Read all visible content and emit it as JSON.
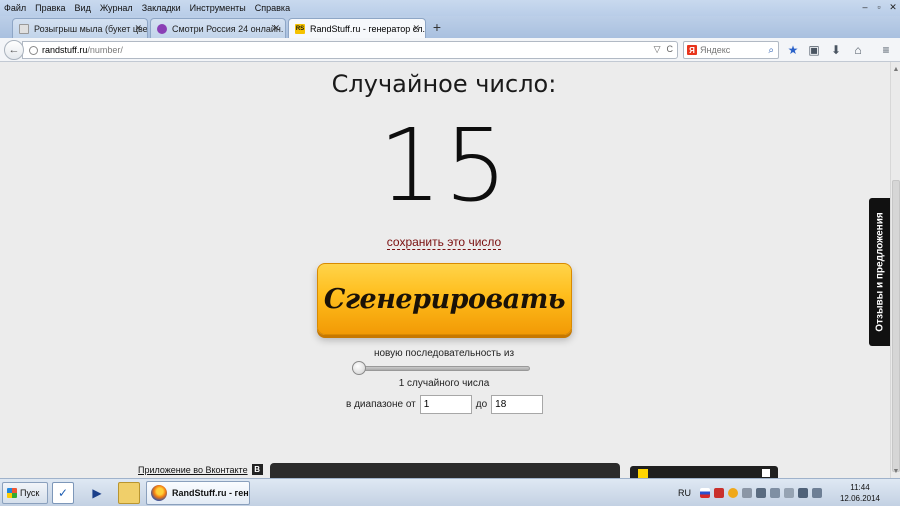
{
  "menu": [
    "Файл",
    "Правка",
    "Вид",
    "Журнал",
    "Закладки",
    "Инструменты",
    "Справка"
  ],
  "window_controls": [
    "–",
    "▫",
    "✕"
  ],
  "tabs": [
    {
      "label": "Розыгрыш мыла (букет цве...",
      "icon": "page-icon",
      "color": "#e0e0e0",
      "close": "✕"
    },
    {
      "label": "Смотри Россия 24 онлайн. В...",
      "icon": "tv-icon",
      "color": "#8a3fb5",
      "close": "✕"
    },
    {
      "label": "RandStuff.ru - генератор сл...",
      "icon": "randstuff-favicon",
      "color": "#f5c200",
      "favicon_text": "RS",
      "close": "✕"
    }
  ],
  "newtab": "+",
  "nav": {
    "back": "←",
    "url_domain": "randstuff.ru",
    "url_path": "/number/",
    "url_actions": [
      "▽",
      "C"
    ],
    "search_engine_letter": "Я",
    "search_placeholder": "Яндекс",
    "search_icon": "⌕",
    "toolbar_icons": [
      "★",
      "▣",
      "⬇",
      "⌂",
      "≡"
    ]
  },
  "page": {
    "heading": "Случайное число:",
    "number": "15",
    "save_link": "сохранить это число",
    "generate_button": "Сгенерировать",
    "sequence_label": "новую последовательность из",
    "count_label": "1 случайного числа",
    "range_from_label": "в диапазоне от",
    "range_from_value": "1",
    "range_to_label": "до",
    "range_to_value": "18",
    "feedback_tab": "Отзывы и предложения",
    "vk_app_link": "Приложение во Вконтакте",
    "vk_logo": "B",
    "slider_fraction": 0
  },
  "scrollbar": {
    "up": "▲",
    "down": "▼"
  },
  "taskbar": {
    "start_label": "Пуск",
    "active_task": "RandStuff.ru - генер...",
    "lang": "RU",
    "time": "11:44",
    "date": "12.06.2014"
  }
}
